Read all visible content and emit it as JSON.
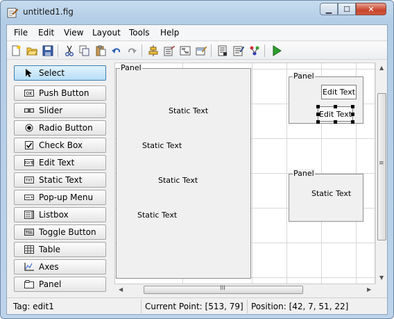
{
  "window": {
    "title": "untitled1.fig",
    "min_label": "▁",
    "max_label": "☐",
    "close_label": "✕"
  },
  "menu": [
    "File",
    "Edit",
    "View",
    "Layout",
    "Tools",
    "Help"
  ],
  "toolbar_icons": [
    "new-figure-icon",
    "open-file-icon",
    "save-icon",
    "cut-icon",
    "copy-icon",
    "paste-icon",
    "undo-icon",
    "redo-icon",
    "align-objects-icon",
    "menu-editor-icon",
    "tab-order-editor-icon",
    "toolbar-editor-icon",
    "mfile-editor-icon",
    "property-inspector-icon",
    "object-browser-icon",
    "run-figure-icon"
  ],
  "palette": [
    {
      "label": "Select",
      "icon": "arrow-pointer-icon",
      "selected": true
    },
    {
      "label": "Push Button",
      "icon": "push-button-icon"
    },
    {
      "label": "Slider",
      "icon": "slider-icon"
    },
    {
      "label": "Radio Button",
      "icon": "radio-button-icon"
    },
    {
      "label": "Check Box",
      "icon": "check-box-icon"
    },
    {
      "label": "Edit Text",
      "icon": "edit-text-icon"
    },
    {
      "label": "Static Text",
      "icon": "static-text-icon"
    },
    {
      "label": "Pop-up Menu",
      "icon": "popup-menu-icon"
    },
    {
      "label": "Listbox",
      "icon": "listbox-icon"
    },
    {
      "label": "Toggle Button",
      "icon": "toggle-button-icon"
    },
    {
      "label": "Table",
      "icon": "table-icon"
    },
    {
      "label": "Axes",
      "icon": "axes-icon"
    },
    {
      "label": "Panel",
      "icon": "panel-icon"
    }
  ],
  "layout": {
    "big_panel": {
      "title": "Panel",
      "static_texts": [
        "Static Text",
        "Static Text",
        "Static Text",
        "Static Text"
      ]
    },
    "panel_top_right": {
      "title": "Panel",
      "edit_1": "Edit Text",
      "edit_2": "Edit Text"
    },
    "panel_bottom_right": {
      "title": "Panel",
      "static_text": "Static Text"
    },
    "hscroll_grip": "III",
    "vscroll_grip": "≡"
  },
  "status": {
    "tag": "Tag: edit1",
    "current_point": "Current Point:  [513, 79]",
    "position": "Position: [42, 7, 51, 22]"
  }
}
